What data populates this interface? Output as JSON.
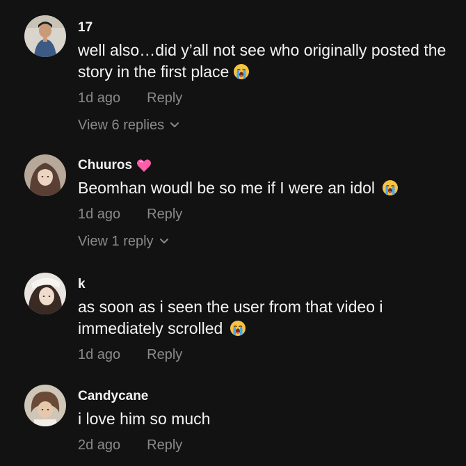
{
  "comments": [
    {
      "username": "17",
      "text": "well also…did y’all not see who originally posted the story in the first place",
      "emoji": "crying-face",
      "time": "1d ago",
      "reply": "Reply",
      "view_replies": "View 6 replies"
    },
    {
      "username": "Chuuros",
      "badge": "pink-heart",
      "text": "Beomhan woudl be so me if I were an idol",
      "emoji": "crying-face",
      "time": "1d ago",
      "reply": "Reply",
      "view_replies": "View 1 reply"
    },
    {
      "username": "k",
      "text": "as soon as i seen the user from that video i immediately scrolled",
      "emoji": "crying-face",
      "time": "1d ago",
      "reply": "Reply"
    },
    {
      "username": "Candycane",
      "text": "i love him so much",
      "time": "2d ago",
      "reply": "Reply"
    }
  ],
  "colors": {
    "background": "#121212",
    "primary_text": "#f4f4f4",
    "secondary_text": "#8a8a8a",
    "heart": "#ff5fa8"
  }
}
